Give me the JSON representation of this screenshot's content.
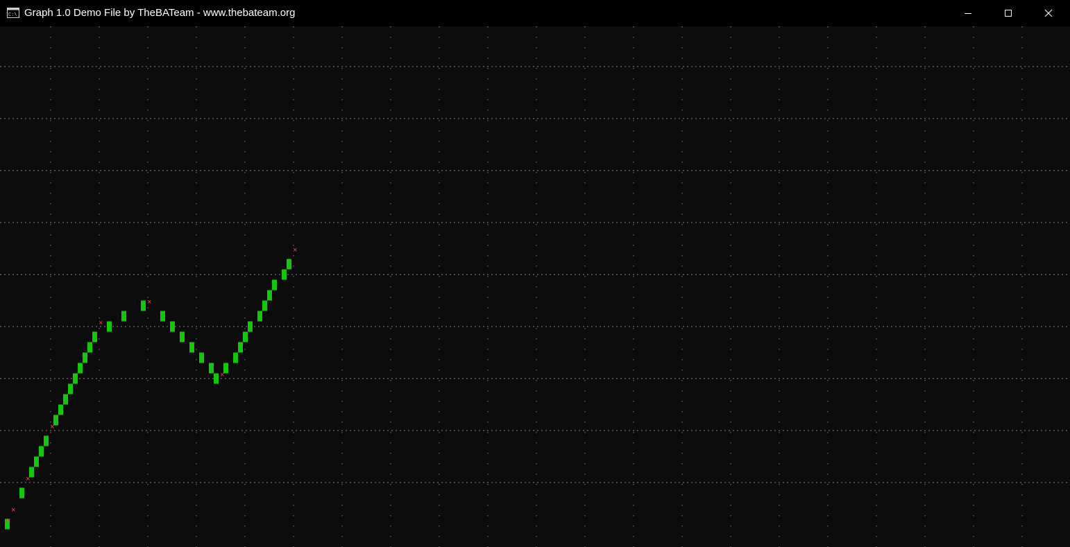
{
  "window": {
    "title": "Graph 1.0 Demo File by TheBATeam - www.thebateam.org",
    "icon": "console-icon",
    "controls": [
      "minimize-icon",
      "maximize-icon",
      "close-icon"
    ]
  },
  "colors": {
    "background": "#0c0c0c",
    "titlebar": "#000000",
    "grid_dots": "#8a8a8a",
    "series_bar": "#16c60c",
    "data_point_marker": "#e74856"
  },
  "chart_data": {
    "type": "line",
    "xlim": [
      0,
      220
    ],
    "ylim": [
      0,
      10
    ],
    "grid": "dotted",
    "markers": [
      {
        "x": 1,
        "y": 0.2
      },
      {
        "x": 2,
        "y": 0.4
      },
      {
        "x": 5,
        "y": 1.0
      },
      {
        "x": 10,
        "y": 2.0
      },
      {
        "x": 20,
        "y": 4.0
      },
      {
        "x": 30,
        "y": 4.4
      },
      {
        "x": 45,
        "y": 3.0
      },
      {
        "x": 60,
        "y": 5.4
      }
    ],
    "series": [
      {
        "values": [
          {
            "x": 1,
            "y": 0.2
          },
          {
            "x": 4,
            "y": 0.8
          },
          {
            "x": 6,
            "y": 1.2
          },
          {
            "x": 7,
            "y": 1.4
          },
          {
            "x": 8,
            "y": 1.6
          },
          {
            "x": 9,
            "y": 1.8
          },
          {
            "x": 11,
            "y": 2.2
          },
          {
            "x": 12,
            "y": 2.4
          },
          {
            "x": 13,
            "y": 2.6
          },
          {
            "x": 14,
            "y": 2.8
          },
          {
            "x": 15,
            "y": 3.0
          },
          {
            "x": 16,
            "y": 3.2
          },
          {
            "x": 17,
            "y": 3.4
          },
          {
            "x": 18,
            "y": 3.6
          },
          {
            "x": 19,
            "y": 3.8
          },
          {
            "x": 22,
            "y": 4.0
          },
          {
            "x": 25,
            "y": 4.2
          },
          {
            "x": 29,
            "y": 4.4
          },
          {
            "x": 33,
            "y": 4.2
          },
          {
            "x": 35,
            "y": 4.0
          },
          {
            "x": 37,
            "y": 3.8
          },
          {
            "x": 39,
            "y": 3.6
          },
          {
            "x": 41,
            "y": 3.4
          },
          {
            "x": 43,
            "y": 3.2
          },
          {
            "x": 44,
            "y": 3.0
          },
          {
            "x": 46,
            "y": 3.2
          },
          {
            "x": 48,
            "y": 3.4
          },
          {
            "x": 49,
            "y": 3.6
          },
          {
            "x": 50,
            "y": 3.8
          },
          {
            "x": 51,
            "y": 4.0
          },
          {
            "x": 53,
            "y": 4.2
          },
          {
            "x": 54,
            "y": 4.4
          },
          {
            "x": 55,
            "y": 4.6
          },
          {
            "x": 56,
            "y": 4.8
          },
          {
            "x": 58,
            "y": 5.0
          },
          {
            "x": 59,
            "y": 5.2
          }
        ]
      }
    ]
  }
}
